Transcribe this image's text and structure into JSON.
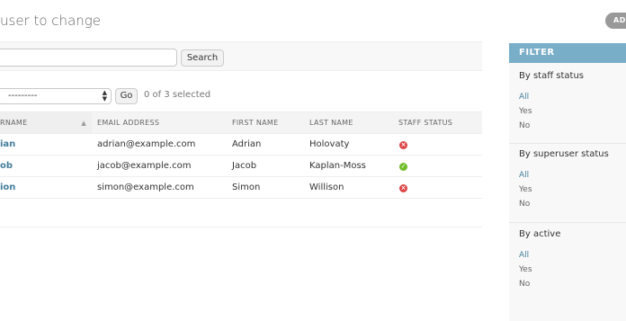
{
  "page": {
    "title": "user to change",
    "add_label": "ADD"
  },
  "search": {
    "value": "",
    "placeholder": "",
    "button_label": "Search"
  },
  "actions": {
    "selected_option": "---------",
    "go_label": "Go",
    "selected_count": "0 of 3 selected"
  },
  "table": {
    "columns": {
      "username": "RNAME",
      "email": "EMAIL ADDRESS",
      "first_name": "FIRST NAME",
      "last_name": "LAST NAME",
      "staff_status": "STAFF STATUS"
    },
    "rows": [
      {
        "username": "ian",
        "email": "adrian@example.com",
        "first_name": "Adrian",
        "last_name": "Holovaty",
        "staff": "no",
        "staff_symbol": "×"
      },
      {
        "username": "ob",
        "email": "jacob@example.com",
        "first_name": "Jacob",
        "last_name": "Kaplan-Moss",
        "staff": "yes",
        "staff_symbol": "✓"
      },
      {
        "username": "ion",
        "email": "simon@example.com",
        "first_name": "Simon",
        "last_name": "Willison",
        "staff": "no",
        "staff_symbol": "×"
      }
    ]
  },
  "filter": {
    "header": "FILTER",
    "groups": [
      {
        "title": "By staff status",
        "options": [
          "All",
          "Yes",
          "No"
        ],
        "selected": "All"
      },
      {
        "title": "By superuser status",
        "options": [
          "All",
          "Yes",
          "No"
        ],
        "selected": "All"
      },
      {
        "title": "By active",
        "options": [
          "All",
          "Yes",
          "No"
        ],
        "selected": "All"
      }
    ]
  },
  "colors": {
    "link": "#447e9b",
    "filter_header": "#79aec8",
    "status_no": "#dd4646",
    "status_yes": "#70bf2b"
  },
  "icons": {
    "sort": "sort-ascending-icon",
    "status_no": "status-no-icon",
    "status_yes": "status-yes-icon",
    "select_arrows": "select-arrows-icon"
  }
}
